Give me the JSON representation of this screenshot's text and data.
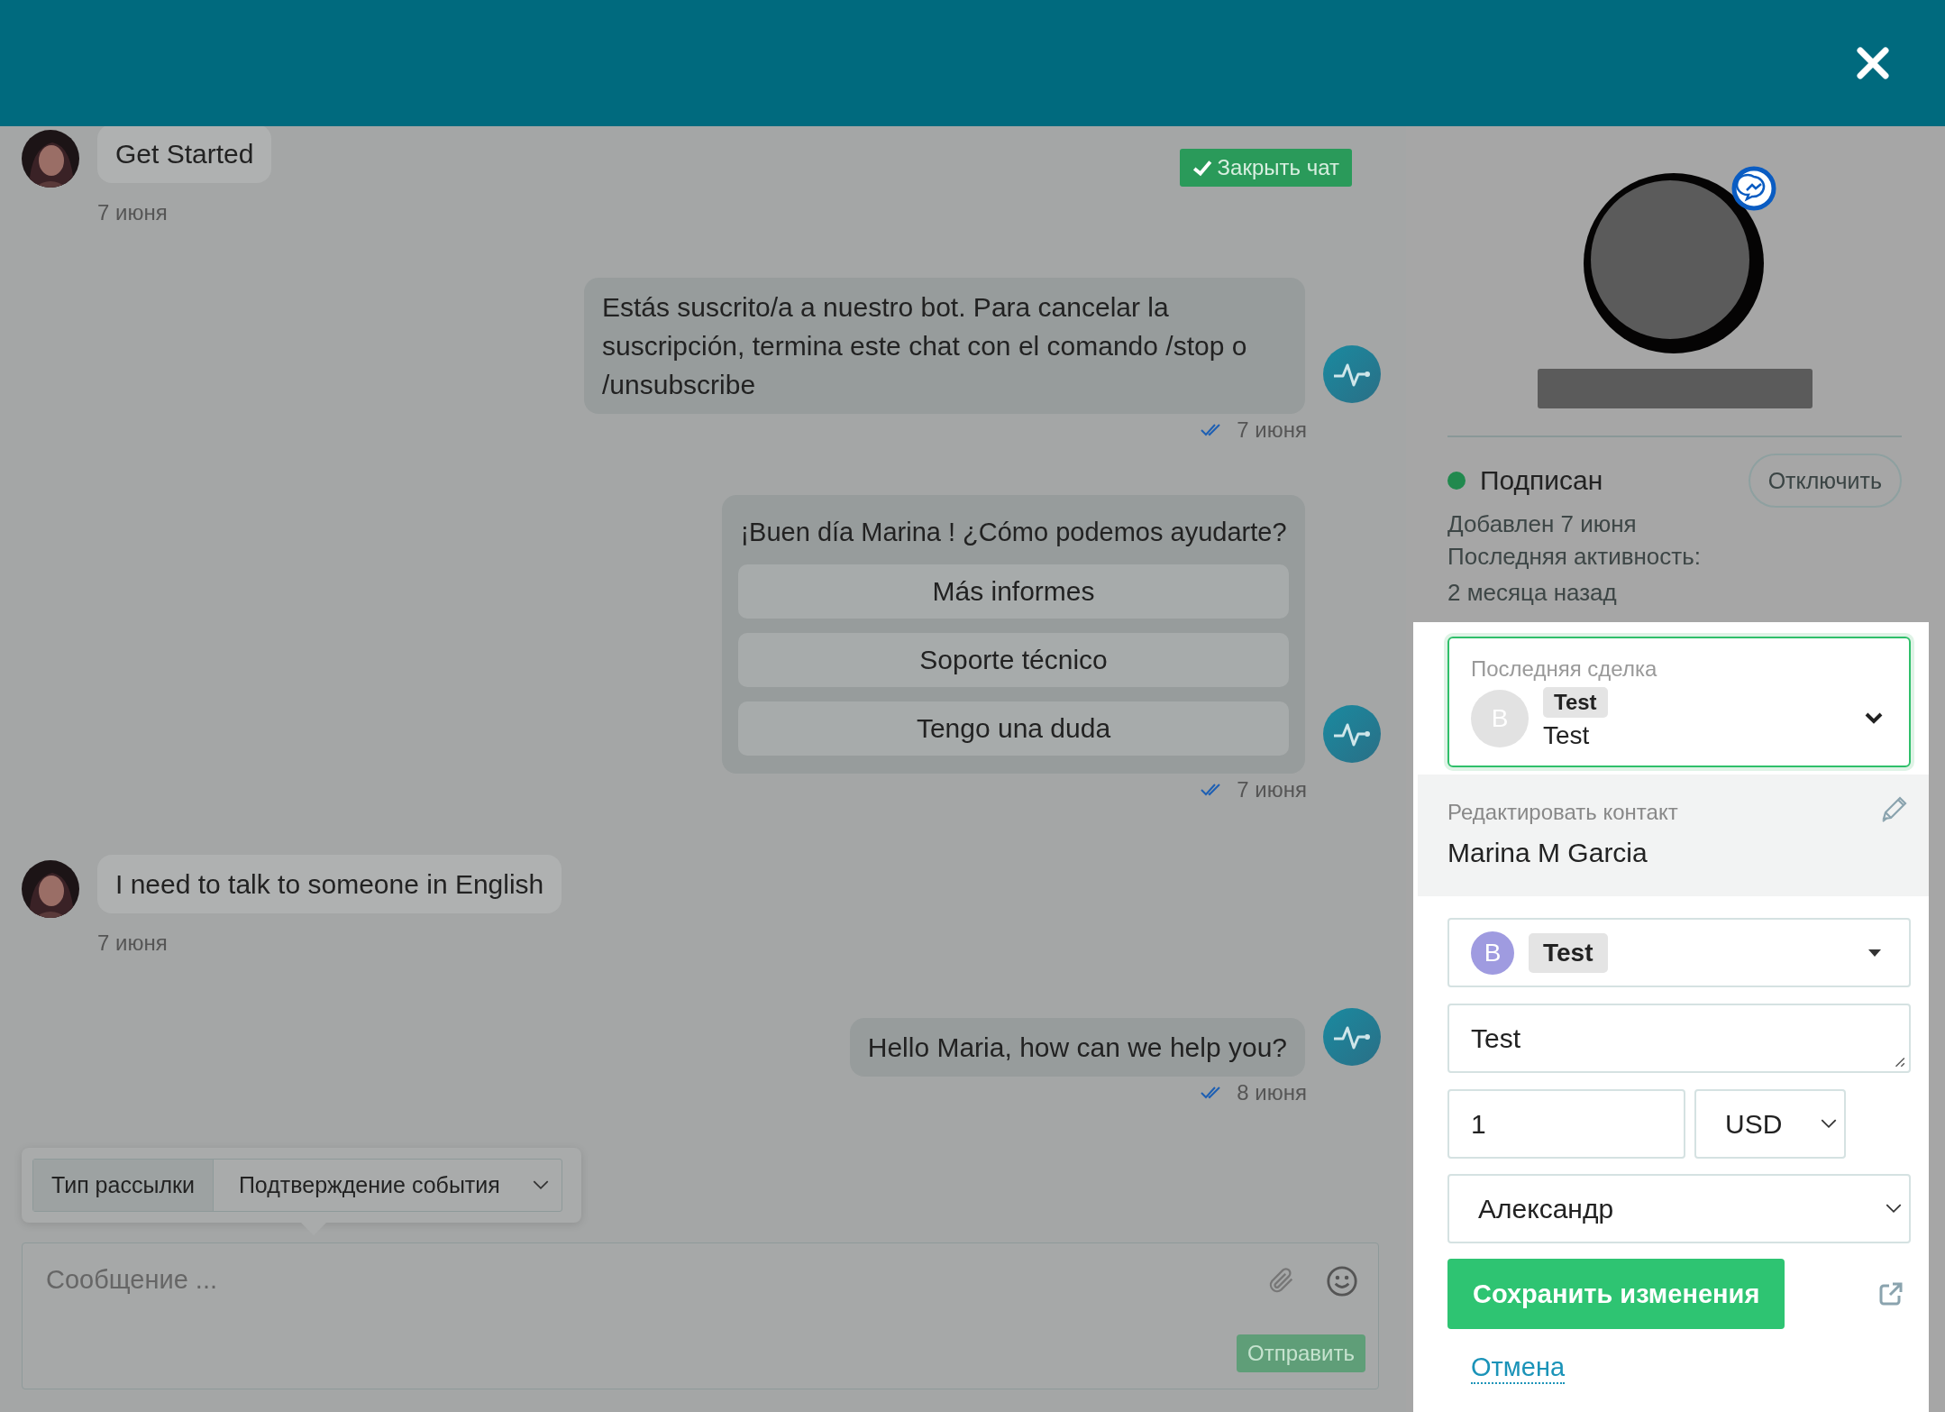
{
  "chat": {
    "close_chat_button": "Закрыть чат",
    "messages": [
      {
        "kind": "user",
        "text": "Get Started",
        "date": "7 июня"
      },
      {
        "kind": "bot",
        "text": "Estás suscrito/a a nuestro bot. Para cancelar la suscripción, termina este chat con el comando /stop o /unsubscribe",
        "date": "7 июня",
        "read": true
      },
      {
        "kind": "bot",
        "text": "¡Buen día Marina ! ¿Cómo podemos ayudarte?",
        "buttons": [
          "Más informes",
          "Soporte técnico",
          "Tengo una duda"
        ],
        "date": "7 июня",
        "read": true
      },
      {
        "kind": "user",
        "text": "I need to talk to someone in English",
        "date": "7 июня"
      },
      {
        "kind": "bot",
        "text": "Hello Maria, how can we help you?",
        "date": "8 июня",
        "read": true
      }
    ]
  },
  "composer": {
    "type_label": "Тип рассылки",
    "type_value": "Подтверждение события",
    "placeholder": "Сообщение ...",
    "send_button": "Отправить"
  },
  "contact": {
    "status": "Подписан",
    "subscribed": true,
    "unsubscribe_button": "Отключить",
    "added": "Добавлен 7 июня",
    "last_activity_label": "Последняя активность:",
    "last_activity": "2 месяца назад"
  },
  "deal_card": {
    "label": "Последняя сделка",
    "avatar_letter": "B",
    "tag": "Test",
    "name": "Test"
  },
  "edit": {
    "label": "Редактировать контакт",
    "name": "Marina M Garcia",
    "pipeline_letter": "B",
    "pipeline_tag": "Test",
    "title": "Test",
    "amount": "1",
    "currency": "USD",
    "owner": "Александр",
    "save_button": "Сохранить изменения",
    "cancel_link": "Отмена"
  }
}
